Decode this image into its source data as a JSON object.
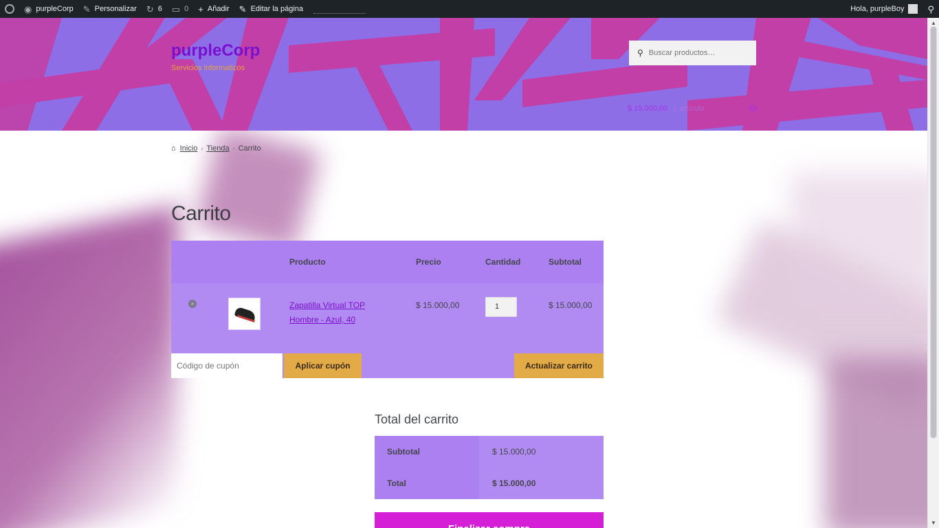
{
  "adminbar": {
    "site_name": "purpleCorp",
    "customize": "Personalizar",
    "updates_count": "6",
    "comments_count": "0",
    "add_new": "Añadir",
    "edit_page": "Editar la página",
    "greeting": "Hola, purpleBoy"
  },
  "header": {
    "site_title": "purpleCorp",
    "tagline": "Servicios informaticos",
    "search_placeholder": "Buscar productos…",
    "cart_amount": "$ 15.000,00",
    "cart_items": "1 artículo"
  },
  "breadcrumb": {
    "home": "Inicio",
    "shop": "Tienda",
    "current": "Carrito"
  },
  "page": {
    "title": "Carrito"
  },
  "cart": {
    "columns": {
      "product": "Producto",
      "price": "Precio",
      "quantity": "Cantidad",
      "subtotal": "Subtotal"
    },
    "items": [
      {
        "name": "Zapatilla Virtual TOP Hombre - Azul, 40",
        "price": "$ 15.000,00",
        "quantity": "1",
        "subtotal": "$ 15.000,00"
      }
    ],
    "coupon_placeholder": "Código de cupón",
    "apply_coupon": "Aplicar cupón",
    "update_cart": "Actualizar carrito"
  },
  "totals": {
    "title": "Total del carrito",
    "subtotal_label": "Subtotal",
    "subtotal_value": "$ 15.000,00",
    "total_label": "Total",
    "total_value": "$ 15.000,00",
    "checkout": "Finalizar compra"
  },
  "colors": {
    "header_bg": "#8e6ee6",
    "header_accent": "#c13fa6",
    "table_bg": "#b18bf2",
    "button": "#e2ab48",
    "checkout": "#d41fd6",
    "link": "#7a0fd0"
  }
}
